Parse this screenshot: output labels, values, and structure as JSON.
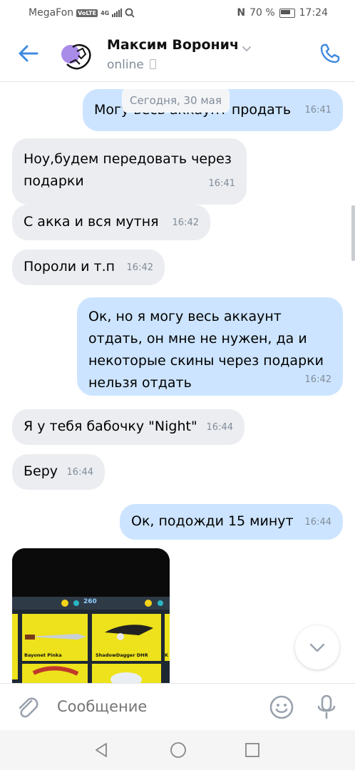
{
  "status_bar": {
    "carrier": "MegaFon",
    "volte": "VoLTE",
    "network": "4G",
    "nfc": "N",
    "battery_percent": "70 %",
    "time": "17:24"
  },
  "header": {
    "contact_name": "Максим Воронич",
    "status": "online",
    "icons": [
      "back-arrow-icon",
      "chevron-down-icon",
      "phone-icon",
      "mobile-icon"
    ]
  },
  "chat": {
    "date_chip": "Сегодня, 30 мая",
    "messages": [
      {
        "dir": "out",
        "text": "Могу весь аккаунт продать",
        "time": "16:41"
      },
      {
        "dir": "in",
        "text": "Ноу,будем передовать через подарки",
        "time": "16:41"
      },
      {
        "dir": "in",
        "text": "С акка и вся мутня",
        "time": "16:42"
      },
      {
        "dir": "in",
        "text": "Пороли и т.п",
        "time": "16:42"
      },
      {
        "dir": "out",
        "text": "Ок, но я могу весь аккаунт отдать, он мне не нужен, да и некоторые скины через подарки нельзя отдать",
        "time": "16:42"
      },
      {
        "dir": "in",
        "text": "Я у тебя бабочку \"Night\"",
        "time": "16:44"
      },
      {
        "dir": "in",
        "text": "Беру",
        "time": "16:44"
      },
      {
        "dir": "out",
        "text": "Ок, подожди 15 минут",
        "time": "16:44"
      }
    ],
    "photo": {
      "coins": "260",
      "items": [
        "Bayonet Pinka",
        "ShadowDagger DHR",
        "K"
      ]
    }
  },
  "composer": {
    "placeholder": "Сообщение"
  },
  "colors": {
    "accent": "#3f8ae0",
    "incoming_bubble": "#ebedf0",
    "outgoing_bubble": "#cce4ff",
    "secondary_text": "#818c99"
  }
}
